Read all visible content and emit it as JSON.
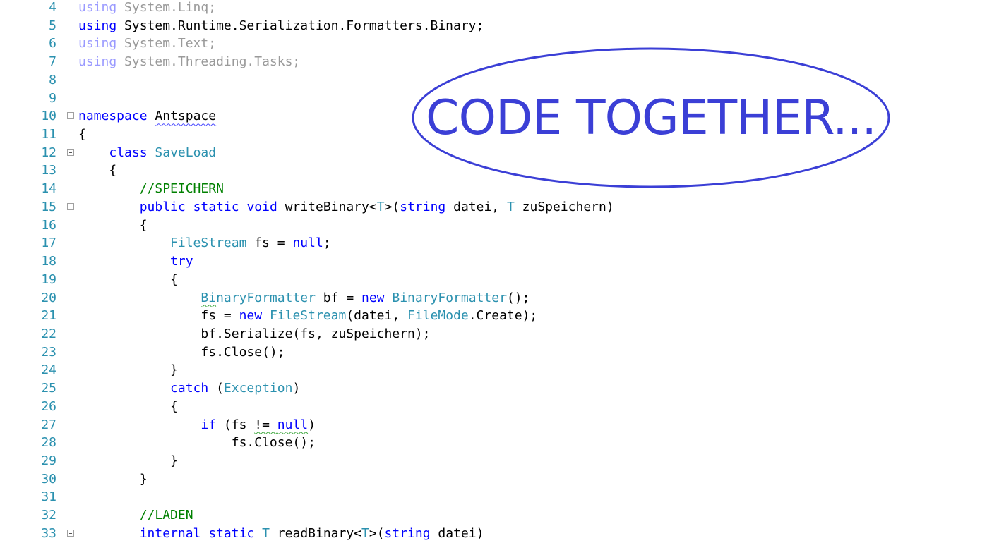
{
  "editor": {
    "lines": [
      {
        "n": "4",
        "fold": false,
        "tokens": [
          [
            "using",
            "fk"
          ],
          [
            " System.Linq;",
            "fp"
          ]
        ]
      },
      {
        "n": "5",
        "fold": false,
        "tokens": [
          [
            "using",
            "k"
          ],
          [
            " System.Runtime.Serialization.Formatters.Binary;",
            "p"
          ]
        ]
      },
      {
        "n": "6",
        "fold": false,
        "tokens": [
          [
            "using",
            "fk"
          ],
          [
            " System.Text;",
            "fp"
          ]
        ]
      },
      {
        "n": "7",
        "fold": false,
        "tokens": [
          [
            "using",
            "fk"
          ],
          [
            " System.Threading.Tasks;",
            "fp"
          ]
        ]
      },
      {
        "n": "8",
        "fold": false,
        "tokens": []
      },
      {
        "n": "9",
        "fold": false,
        "tokens": []
      },
      {
        "n": "10",
        "fold": true,
        "tokens": [
          [
            "namespace",
            "k"
          ],
          [
            " ",
            "p"
          ],
          [
            "Antspace",
            "p sqb"
          ]
        ]
      },
      {
        "n": "11",
        "fold": false,
        "tokens": [
          [
            "{",
            "p"
          ]
        ]
      },
      {
        "n": "12",
        "fold": true,
        "tokens": [
          [
            "    ",
            "p"
          ],
          [
            "class",
            "k"
          ],
          [
            " ",
            "p"
          ],
          [
            "SaveLoad",
            "t"
          ]
        ]
      },
      {
        "n": "13",
        "fold": false,
        "tokens": [
          [
            "    {",
            "p"
          ]
        ]
      },
      {
        "n": "14",
        "fold": false,
        "tokens": [
          [
            "        ",
            "p"
          ],
          [
            "//SPEICHERN",
            "c"
          ]
        ]
      },
      {
        "n": "15",
        "fold": true,
        "tokens": [
          [
            "        ",
            "p"
          ],
          [
            "public",
            "k"
          ],
          [
            " ",
            "p"
          ],
          [
            "static",
            "k"
          ],
          [
            " ",
            "p"
          ],
          [
            "void",
            "k"
          ],
          [
            " writeBinary<",
            "p"
          ],
          [
            "T",
            "t"
          ],
          [
            ">(",
            "p"
          ],
          [
            "string",
            "k"
          ],
          [
            " datei, ",
            "p"
          ],
          [
            "T",
            "t"
          ],
          [
            " zuSpeichern)",
            "p"
          ]
        ]
      },
      {
        "n": "16",
        "fold": false,
        "tokens": [
          [
            "        {",
            "p"
          ]
        ]
      },
      {
        "n": "17",
        "fold": false,
        "tokens": [
          [
            "            ",
            "p"
          ],
          [
            "FileStream",
            "t"
          ],
          [
            " fs = ",
            "p"
          ],
          [
            "null",
            "k"
          ],
          [
            ";",
            "p"
          ]
        ]
      },
      {
        "n": "18",
        "fold": false,
        "tokens": [
          [
            "            ",
            "p"
          ],
          [
            "try",
            "k"
          ]
        ]
      },
      {
        "n": "19",
        "fold": false,
        "tokens": [
          [
            "            {",
            "p"
          ]
        ]
      },
      {
        "n": "20",
        "fold": false,
        "tokens": [
          [
            "                ",
            "p"
          ],
          [
            "Bi",
            "t sqg"
          ],
          [
            "naryFormatter",
            "t"
          ],
          [
            " bf = ",
            "p"
          ],
          [
            "new",
            "k"
          ],
          [
            " ",
            "p"
          ],
          [
            "BinaryFormatter",
            "t"
          ],
          [
            "();",
            "p"
          ]
        ]
      },
      {
        "n": "21",
        "fold": false,
        "tokens": [
          [
            "                fs = ",
            "p"
          ],
          [
            "new",
            "k"
          ],
          [
            " ",
            "p"
          ],
          [
            "FileStream",
            "t"
          ],
          [
            "(datei, ",
            "p"
          ],
          [
            "FileMode",
            "t"
          ],
          [
            ".Create);",
            "p"
          ]
        ]
      },
      {
        "n": "22",
        "fold": false,
        "tokens": [
          [
            "                bf.Serialize(fs, zuSpeichern);",
            "p"
          ]
        ]
      },
      {
        "n": "23",
        "fold": false,
        "tokens": [
          [
            "                fs.Close();",
            "p"
          ]
        ]
      },
      {
        "n": "24",
        "fold": false,
        "tokens": [
          [
            "            }",
            "p"
          ]
        ]
      },
      {
        "n": "25",
        "fold": false,
        "tokens": [
          [
            "            ",
            "p"
          ],
          [
            "catch",
            "k"
          ],
          [
            " (",
            "p"
          ],
          [
            "Exception",
            "t"
          ],
          [
            ")",
            "p"
          ]
        ]
      },
      {
        "n": "26",
        "fold": false,
        "tokens": [
          [
            "            {",
            "p"
          ]
        ]
      },
      {
        "n": "27",
        "fold": false,
        "tokens": [
          [
            "                ",
            "p"
          ],
          [
            "if",
            "k"
          ],
          [
            " (fs ",
            "p"
          ],
          [
            "!= ",
            "p sqg"
          ],
          [
            "null",
            "k sqg"
          ],
          [
            ")",
            "p"
          ]
        ]
      },
      {
        "n": "28",
        "fold": false,
        "tokens": [
          [
            "                    fs.Close();",
            "p"
          ]
        ]
      },
      {
        "n": "29",
        "fold": false,
        "tokens": [
          [
            "            }",
            "p"
          ]
        ]
      },
      {
        "n": "30",
        "fold": false,
        "tokens": [
          [
            "        }",
            "p"
          ]
        ]
      },
      {
        "n": "31",
        "fold": false,
        "tokens": []
      },
      {
        "n": "32",
        "fold": false,
        "tokens": [
          [
            "        ",
            "p"
          ],
          [
            "//LADEN",
            "c"
          ]
        ]
      },
      {
        "n": "33",
        "fold": true,
        "tokens": [
          [
            "        ",
            "p"
          ],
          [
            "internal",
            "k"
          ],
          [
            " ",
            "p"
          ],
          [
            "static",
            "k"
          ],
          [
            " ",
            "p"
          ],
          [
            "T",
            "t"
          ],
          [
            " readBinary<",
            "p"
          ],
          [
            "T",
            "t"
          ],
          [
            ">(",
            "p"
          ],
          [
            "string",
            "k"
          ],
          [
            " datei)",
            "p"
          ]
        ]
      }
    ]
  },
  "overlay": {
    "text": "CODE TOGETHER...",
    "color": "#3b3fd6"
  },
  "colors": {
    "keyword": "#0000ff",
    "type": "#2b91af",
    "comment": "#008000",
    "line_number": "#2b91af"
  }
}
